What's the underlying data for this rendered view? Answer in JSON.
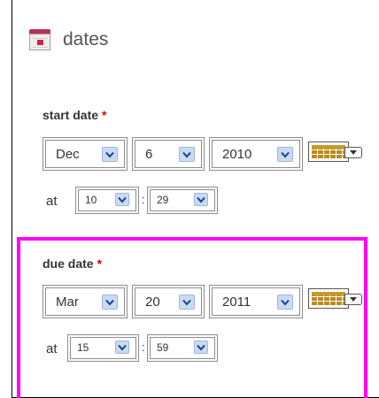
{
  "section": {
    "title": "dates",
    "icon": "calendar-icon"
  },
  "start": {
    "label": "start date",
    "required_mark": "*",
    "month": "Dec",
    "day": "6",
    "year": "2010",
    "at_label": "at",
    "hour": "10",
    "minute": "29",
    "separator": ":"
  },
  "due": {
    "label": "due date",
    "required_mark": "*",
    "month": "Mar",
    "day": "20",
    "year": "2011",
    "at_label": "at",
    "hour": "15",
    "minute": "59",
    "separator": ":"
  },
  "colors": {
    "highlight": "#ff00ff",
    "required": "#e00000",
    "select_arrow": "#c9daf3"
  }
}
